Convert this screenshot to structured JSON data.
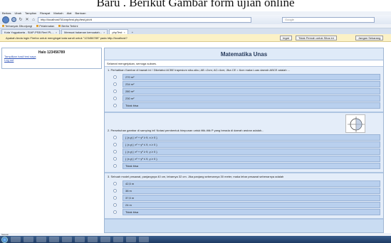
{
  "caption": "Baru . Berikut Gambar form ujian online",
  "window": {
    "title": "phpTest - Mozilla Firefox"
  },
  "menu": [
    "Berkas",
    "Ubah",
    "Tampilan",
    "Riwayat",
    "Markah",
    "Alat",
    "Bantuan"
  ],
  "url": "http://localhost/TA/cnp/test.php/test.job/d",
  "search_placeholder": "Google",
  "bookmarks": [
    "Terbanyak Dikunjungi",
    "Pelatenalan",
    "Berita Terkini"
  ],
  "tabs": [
    {
      "label": "Kota Yogyakarta - SIAP-PSB Reel PL..."
    },
    {
      "label": "Memuat halaman kemuatah..."
    },
    {
      "label": "phpTest"
    }
  ],
  "notification": {
    "text": "Apakah Anda ingin Firefox untuk mengingat kata sandi untuk \"123456789\" pada http://localhost?",
    "buttons": [
      "Ingat",
      "Tidak Pernah untuk Situs ini",
      "Jangan Sekarang"
    ]
  },
  "sidebar": {
    "user": "Halo 123456789",
    "links": [
      "Tampilkan hasil test saya",
      "Log out"
    ]
  },
  "main": {
    "title": "Matematika Unas",
    "greeting": "Selamat mengerjakan, semoga sukses.",
    "questions": [
      {
        "text": "1. Perhatikan Gambar di bawah ini ! Diketahui ACBE trapesium siku-siku; AB =2cm; AC=4cm; Jika CE = 6cm maka Luas daerah ABCE adalah ...",
        "options": [
          "270 m²",
          "234 m²",
          "280 m²",
          "230 m²",
          "Tidak bisa"
        ]
      },
      {
        "text": "2. Persebuhan gambar di samping ini! Notasi pembentuk himpunan untuk titik-titik P yang berada di daerah arsiran adalah...",
        "options": [
          "{ (x,y) | x² + y² ≥ 9, x ≥ 0 }",
          "{ (x,y) | x² + y² ≤ 9, x ≥ 0 }",
          "{ (x,y) | x² + y² ≥ 9, y ≥ 0 }",
          "{ (x,y) | x² + y² ≤ 9, y ≥ 0 }",
          "Tidak bisa"
        ]
      },
      {
        "text": "3. Sebuah model pesawat, panjangnya 40 cm, lebarnya 32 cm. Jika panjang sebenarnya 30 meter, maka lebar pesawat sebenarnya adalah",
        "options": [
          "42,5 m",
          "38 m",
          "37,5 m",
          "24 m",
          "Tidak bisa"
        ]
      }
    ]
  },
  "status": "Selesai"
}
